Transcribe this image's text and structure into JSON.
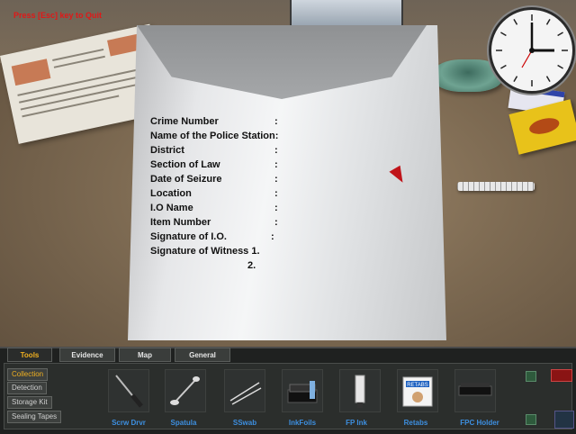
{
  "hint": "Press [Esc] key to Quit",
  "form_rows": [
    {
      "label": "Crime Number",
      "colon": ":"
    },
    {
      "label": "Name of the Police Station:",
      "colon": ""
    },
    {
      "label": "District",
      "colon": ":"
    },
    {
      "label": "Section of Law",
      "colon": ":"
    },
    {
      "label": "Date of Seizure",
      "colon": ":"
    },
    {
      "label": "Location",
      "colon": ":"
    },
    {
      "label": "I.O Name",
      "colon": ":"
    },
    {
      "label": "Item Number",
      "colon": ":"
    },
    {
      "label": "Signature of I.O.",
      "colon": ":"
    },
    {
      "label": "Signature of Witness 1.",
      "colon": ""
    }
  ],
  "witness_2": "2.",
  "tabs": [
    "Tools",
    "Evidence",
    "Map",
    "General"
  ],
  "side_buttons": [
    "Collection",
    "Detection",
    "Storage Kit",
    "Sealing Tapes"
  ],
  "tools": [
    "Scrw Drvr",
    "Spatula",
    "SSwab",
    "InkFoils",
    "FP Ink",
    "Retabs",
    "FPC Holder"
  ],
  "retabs_box_text": "RETABS",
  "colors": {
    "accent": "#f0b020",
    "tool_label": "#3d8fe0",
    "hint": "#e01818"
  },
  "icons": [
    "clock-icon",
    "cursor-icon",
    "screwdriver-icon",
    "spatula-icon",
    "swab-icon",
    "inkfoils-icon",
    "fp-ink-icon",
    "retabs-icon",
    "fpc-holder-icon"
  ]
}
